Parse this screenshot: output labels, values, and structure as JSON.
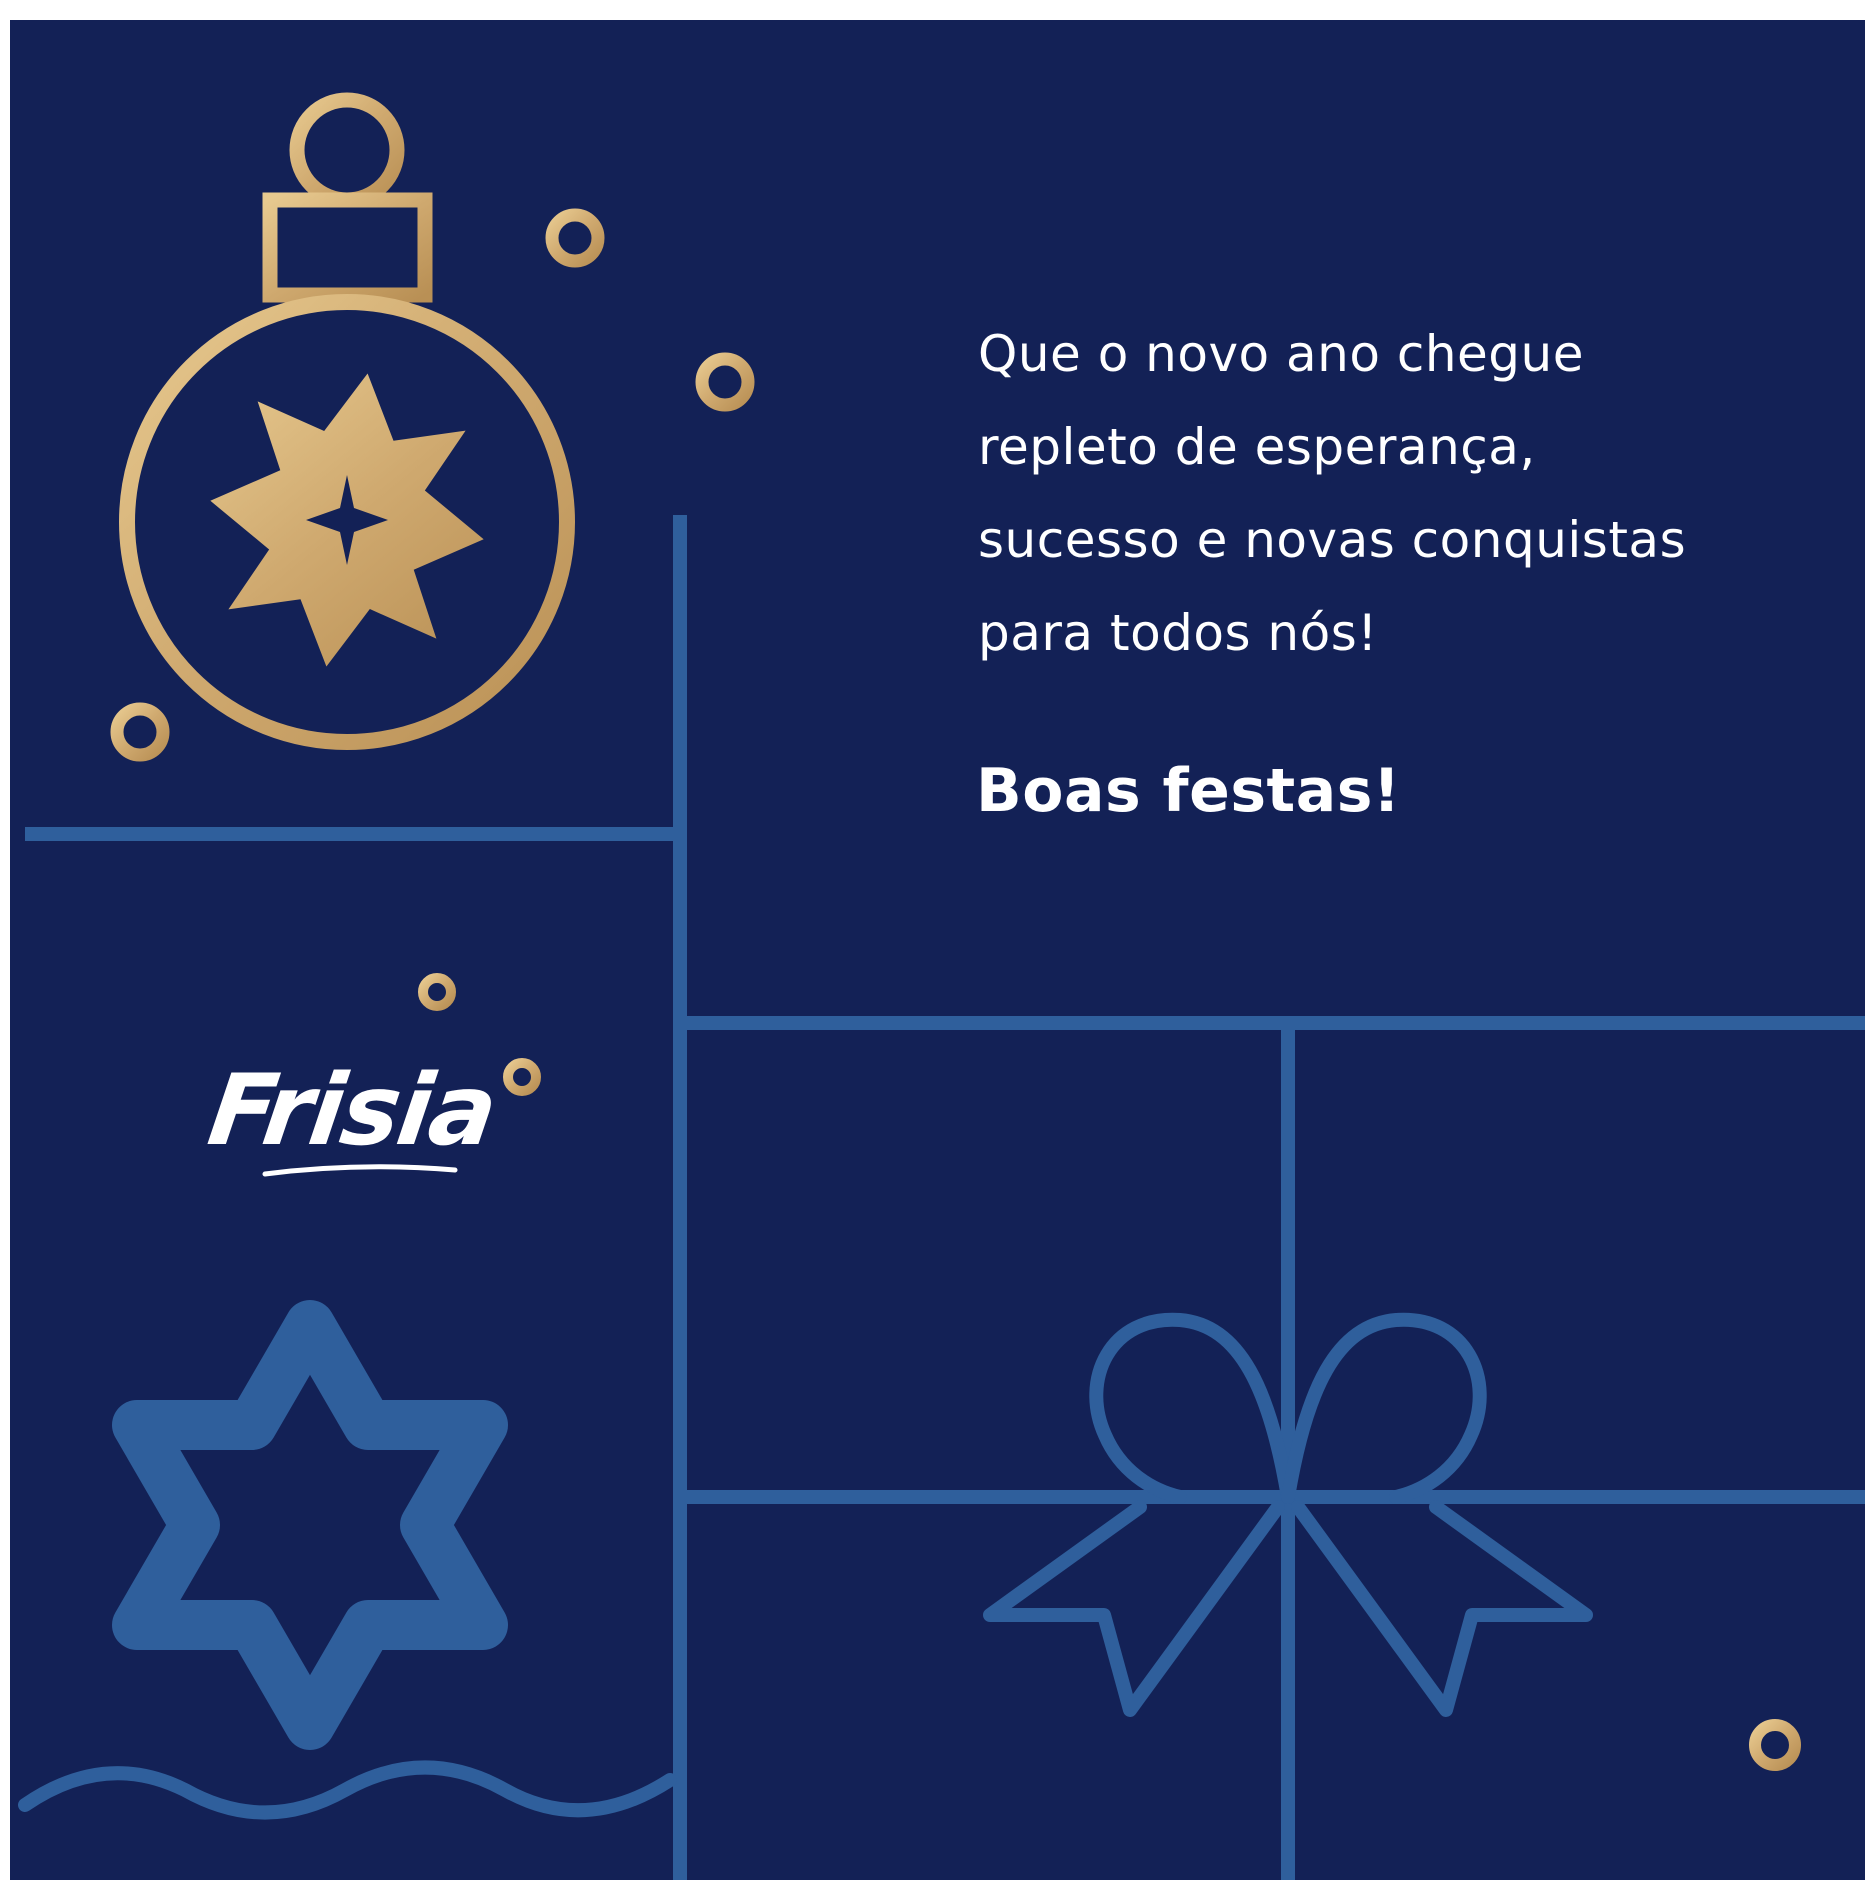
{
  "message": {
    "lines": [
      "Que o novo ano chegue",
      "repleto de esperança,",
      "sucesso e novas conquistas",
      "para todos nós!"
    ],
    "greeting": "Boas festas!"
  },
  "brand": {
    "logo_text": "Frisia"
  },
  "colors": {
    "background": "#132156",
    "gold": "#d6b37a",
    "line_blue": "#2f5f9c",
    "text": "#ffffff"
  },
  "icons": [
    "ornament-icon",
    "star-icon",
    "gift-bow-icon",
    "ring-icon",
    "wave-icon"
  ]
}
